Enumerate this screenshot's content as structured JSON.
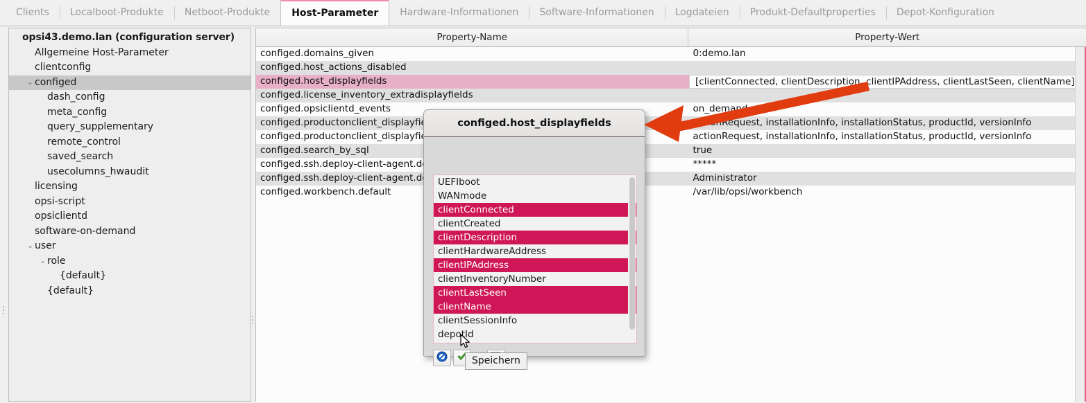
{
  "tabs": [
    {
      "label": "Clients",
      "active": false
    },
    {
      "label": "Localboot-Produkte",
      "active": false
    },
    {
      "label": "Netboot-Produkte",
      "active": false
    },
    {
      "label": "Host-Parameter",
      "active": true
    },
    {
      "label": "Hardware-Informationen",
      "active": false
    },
    {
      "label": "Software-Informationen",
      "active": false
    },
    {
      "label": "Logdateien",
      "active": false
    },
    {
      "label": "Produkt-Defaultproperties",
      "active": false
    },
    {
      "label": "Depot-Konfiguration",
      "active": false
    }
  ],
  "tree": [
    {
      "label": "opsi43.demo.lan (configuration server)",
      "indent": 0,
      "twisty": "",
      "bold": true,
      "selected": false
    },
    {
      "label": "Allgemeine Host-Parameter",
      "indent": 1,
      "twisty": "",
      "bold": false,
      "selected": false
    },
    {
      "label": "clientconfig",
      "indent": 1,
      "twisty": "",
      "bold": false,
      "selected": false
    },
    {
      "label": "configed",
      "indent": 1,
      "twisty": "down",
      "bold": false,
      "selected": true
    },
    {
      "label": "dash_config",
      "indent": 2,
      "twisty": "",
      "bold": false,
      "selected": false
    },
    {
      "label": "meta_config",
      "indent": 2,
      "twisty": "",
      "bold": false,
      "selected": false
    },
    {
      "label": "query_supplementary",
      "indent": 2,
      "twisty": "",
      "bold": false,
      "selected": false
    },
    {
      "label": "remote_control",
      "indent": 2,
      "twisty": "",
      "bold": false,
      "selected": false
    },
    {
      "label": "saved_search",
      "indent": 2,
      "twisty": "",
      "bold": false,
      "selected": false
    },
    {
      "label": "usecolumns_hwaudit",
      "indent": 2,
      "twisty": "",
      "bold": false,
      "selected": false
    },
    {
      "label": "licensing",
      "indent": 1,
      "twisty": "",
      "bold": false,
      "selected": false
    },
    {
      "label": "opsi-script",
      "indent": 1,
      "twisty": "",
      "bold": false,
      "selected": false
    },
    {
      "label": "opsiclientd",
      "indent": 1,
      "twisty": "",
      "bold": false,
      "selected": false
    },
    {
      "label": "software-on-demand",
      "indent": 1,
      "twisty": "",
      "bold": false,
      "selected": false
    },
    {
      "label": "user",
      "indent": 1,
      "twisty": "down",
      "bold": false,
      "selected": false
    },
    {
      "label": "role",
      "indent": 2,
      "twisty": "down",
      "bold": false,
      "selected": false
    },
    {
      "label": "{default}",
      "indent": 3,
      "twisty": "",
      "bold": false,
      "selected": false
    },
    {
      "label": "{default}",
      "indent": 2,
      "twisty": "",
      "bold": false,
      "selected": false
    }
  ],
  "table": {
    "headers": [
      "Property-Name",
      "Property-Wert"
    ],
    "rows": [
      {
        "name": "configed.domains_given",
        "value": "0:demo.lan",
        "selected": false
      },
      {
        "name": "configed.host_actions_disabled",
        "value": "",
        "selected": false
      },
      {
        "name": "configed.host_displayfields",
        "value": "[clientConnected, clientDescription, clientIPAddress, clientLastSeen, clientName]",
        "selected": true
      },
      {
        "name": "configed.license_inventory_extradisplayfields",
        "value": "",
        "selected": false
      },
      {
        "name": "configed.opsiclientd_events",
        "value": "on_demand",
        "selected": false
      },
      {
        "name": "configed.productonclient_displayfields_netboot",
        "value": "actionRequest, installationInfo, installationStatus, productId, versionInfo",
        "selected": false
      },
      {
        "name": "configed.productonclient_displayfields_localboot",
        "value": "actionRequest, installationInfo, installationStatus, productId, versionInfo",
        "selected": false
      },
      {
        "name": "configed.search_by_sql",
        "value": "true",
        "selected": false
      },
      {
        "name": "configed.ssh.deploy-client-agent.default_password",
        "value": "*****",
        "selected": false
      },
      {
        "name": "configed.ssh.deploy-client-agent.default_user",
        "value": "Administrator",
        "selected": false
      },
      {
        "name": "configed.workbench.default",
        "value": "/var/lib/opsi/workbench",
        "selected": false
      }
    ]
  },
  "dialog": {
    "title": "configed.host_displayfields",
    "list_items": [
      {
        "label": "UEFIboot",
        "selected": false
      },
      {
        "label": "WANmode",
        "selected": false
      },
      {
        "label": "clientConnected",
        "selected": true
      },
      {
        "label": "clientCreated",
        "selected": false
      },
      {
        "label": "clientDescription",
        "selected": true
      },
      {
        "label": "clientHardwareAddress",
        "selected": false
      },
      {
        "label": "clientIPAddress",
        "selected": true
      },
      {
        "label": "clientInventoryNumber",
        "selected": false
      },
      {
        "label": "clientLastSeen",
        "selected": true
      },
      {
        "label": "clientName",
        "selected": true
      },
      {
        "label": "clientSessionInfo",
        "selected": false
      },
      {
        "label": "depotId",
        "selected": false
      }
    ],
    "buttons": [
      {
        "name": "cancel-button",
        "icon": "no-entry-icon"
      },
      {
        "name": "save-button",
        "icon": "green-check-icon"
      },
      {
        "name": "reset-button",
        "icon": "list-remove-icon"
      }
    ]
  },
  "tooltip": {
    "text": "Speichern"
  },
  "colors": {
    "tab_accent": "#ef8ab0",
    "row_selected": "#e8b0c7",
    "list_selected": "#cf1656",
    "annotation_arrow": "#e03c10",
    "tree_selected": "#c8c8c8"
  },
  "annotation": {
    "arrow_name": "red-pointer-arrow"
  }
}
